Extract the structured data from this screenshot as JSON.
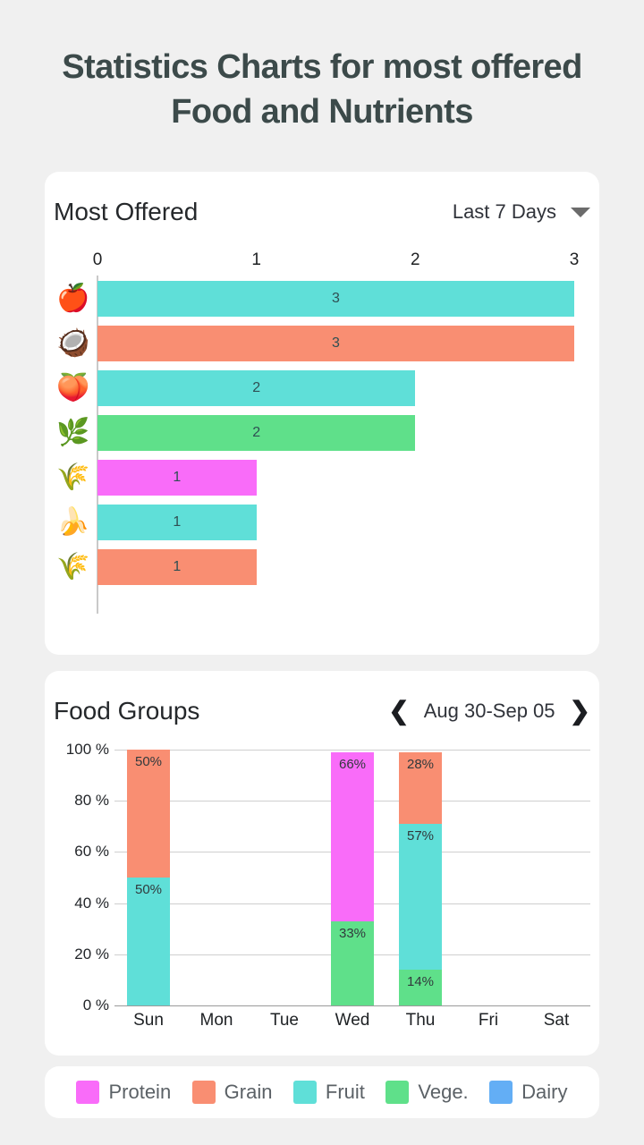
{
  "page": {
    "title": "Statistics Charts for most offered Food and Nutrients",
    "background": "#f0f0f0"
  },
  "most_offered": {
    "title": "Most Offered",
    "range_label": "Last 7 Days",
    "dropdown_icon": "chevron-down-icon"
  },
  "food_groups": {
    "title": "Food Groups",
    "range_label": "Aug 30-Sep 05",
    "prev_icon": "chevron-left-icon",
    "next_icon": "chevron-right-icon"
  },
  "legend": {
    "items": [
      {
        "label": "Protein",
        "color": "#f96cf9"
      },
      {
        "label": "Grain",
        "color": "#f98e72"
      },
      {
        "label": "Fruit",
        "color": "#5fdfd8"
      },
      {
        "label": "Vege.",
        "color": "#5fe08a"
      },
      {
        "label": "Dairy",
        "color": "#63aef5"
      }
    ]
  },
  "chart_data": [
    {
      "type": "bar",
      "orientation": "horizontal",
      "title": "Most Offered",
      "xlabel": "",
      "ylabel": "",
      "xlim": [
        0,
        3
      ],
      "xticks": [
        0,
        1,
        2,
        3
      ],
      "xtick_labels": [
        "0",
        "1",
        "2",
        "3"
      ],
      "grid": false,
      "categories": [
        "apple",
        "coconut",
        "peach",
        "green-onion",
        "seaweed",
        "banana",
        "wheat"
      ],
      "category_icons": [
        "🍎",
        "🥥",
        "🍑",
        "🌿",
        "🌾",
        "🍌",
        "🌾"
      ],
      "values": [
        3,
        3,
        2,
        2,
        1,
        1,
        1
      ],
      "value_labels": [
        "3",
        "3",
        "2",
        "2",
        "1",
        "1",
        "1"
      ],
      "bar_colors": [
        "#5fdfd8",
        "#f98e72",
        "#5fdfd8",
        "#5fe08a",
        "#f96cf9",
        "#5fdfd8",
        "#f98e72"
      ],
      "food_group_of_bar": [
        "Fruit",
        "Grain",
        "Fruit",
        "Vege.",
        "Protein",
        "Fruit",
        "Grain"
      ]
    },
    {
      "type": "bar",
      "subtype": "stacked-percent",
      "title": "Food Groups",
      "xlabel": "",
      "ylabel": "",
      "ylim": [
        0,
        100
      ],
      "yticks": [
        0,
        20,
        40,
        60,
        80,
        100
      ],
      "ytick_labels": [
        "0 %",
        "20 %",
        "40 %",
        "60 %",
        "80 %",
        "100 %"
      ],
      "grid": true,
      "legend_position": "bottom",
      "categories": [
        "Sun",
        "Mon",
        "Tue",
        "Wed",
        "Thu",
        "Fri",
        "Sat"
      ],
      "series": [
        {
          "name": "Protein",
          "color": "#f96cf9",
          "values": [
            0,
            0,
            0,
            66,
            0,
            0,
            0
          ]
        },
        {
          "name": "Grain",
          "color": "#f98e72",
          "values": [
            50,
            0,
            0,
            0,
            28,
            0,
            0
          ]
        },
        {
          "name": "Fruit",
          "color": "#5fdfd8",
          "values": [
            50,
            0,
            0,
            0,
            57,
            0,
            0
          ]
        },
        {
          "name": "Vege.",
          "color": "#5fe08a",
          "values": [
            0,
            0,
            0,
            33,
            14,
            0,
            0
          ]
        },
        {
          "name": "Dairy",
          "color": "#63aef5",
          "values": [
            0,
            0,
            0,
            0,
            0,
            0,
            0
          ]
        }
      ],
      "stack_order_bottom_to_top": [
        "Vege.",
        "Fruit",
        "Protein",
        "Grain",
        "Dairy"
      ],
      "segment_labels": {
        "Sun": [
          {
            "series": "Fruit",
            "value": 50,
            "label": "50%"
          },
          {
            "series": "Grain",
            "value": 50,
            "label": "50%"
          }
        ],
        "Wed": [
          {
            "series": "Vege.",
            "value": 33,
            "label": "33%"
          },
          {
            "series": "Protein",
            "value": 66,
            "label": "66%"
          }
        ],
        "Thu": [
          {
            "series": "Vege.",
            "value": 14,
            "label": "14%"
          },
          {
            "series": "Fruit",
            "value": 57,
            "label": "57%"
          },
          {
            "series": "Grain",
            "value": 28,
            "label": "28%"
          }
        ]
      }
    }
  ]
}
